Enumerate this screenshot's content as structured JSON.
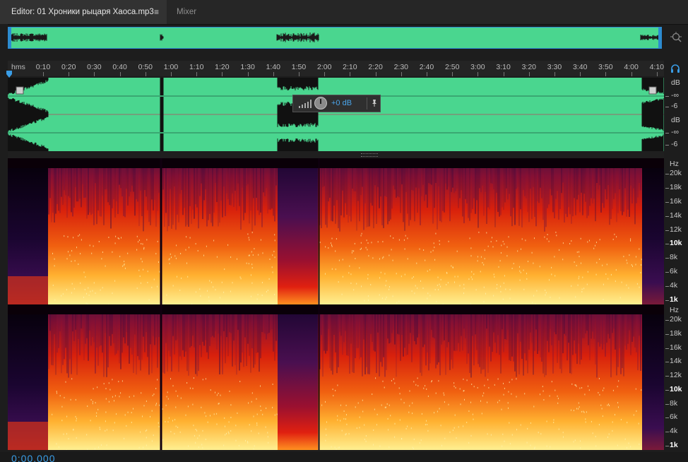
{
  "tabs": {
    "editor_label": "Editor: 01 Хроники рыцаря Хаоса.mp3",
    "editor_menu_icon": "≡",
    "mixer_label": "Mixer"
  },
  "ruler": {
    "format": "hms",
    "labels": [
      "0:10",
      "0:20",
      "0:30",
      "0:40",
      "0:50",
      "1:00",
      "1:10",
      "1:20",
      "1:30",
      "1:40",
      "1:50",
      "2:00",
      "2:10",
      "2:20",
      "2:30",
      "2:40",
      "2:50",
      "3:00",
      "3:10",
      "3:20",
      "3:30",
      "3:40",
      "3:50",
      "4:00",
      "4:10"
    ]
  },
  "gain_hud": {
    "value": "+0 dB",
    "pin_icon": "pin-icon"
  },
  "db_scale": {
    "ch1": [
      "dB",
      "-∞",
      "-6"
    ],
    "ch2": [
      "dB",
      "-∞",
      "-6"
    ]
  },
  "hz_scale": {
    "unit": "Hz",
    "labels": [
      "20k",
      "18k",
      "16k",
      "14k",
      "12k",
      "10k",
      "8k",
      "6k",
      "4k",
      "1k"
    ],
    "bold": [
      "10k",
      "1k"
    ]
  },
  "transport": {
    "time": "0:00.000"
  },
  "colors": {
    "waveform": "#4ad68f",
    "accent": "#2c8bd0",
    "spectral_low": "#ffe37a",
    "spectral_mid": "#e8200a",
    "spectral_high": "#3a1050"
  },
  "icons": [
    "zoom-to-selection-icon",
    "headphones-icon",
    "playhead-icon",
    "menu-icon",
    "pin-icon",
    "gain-knob-icon"
  ]
}
